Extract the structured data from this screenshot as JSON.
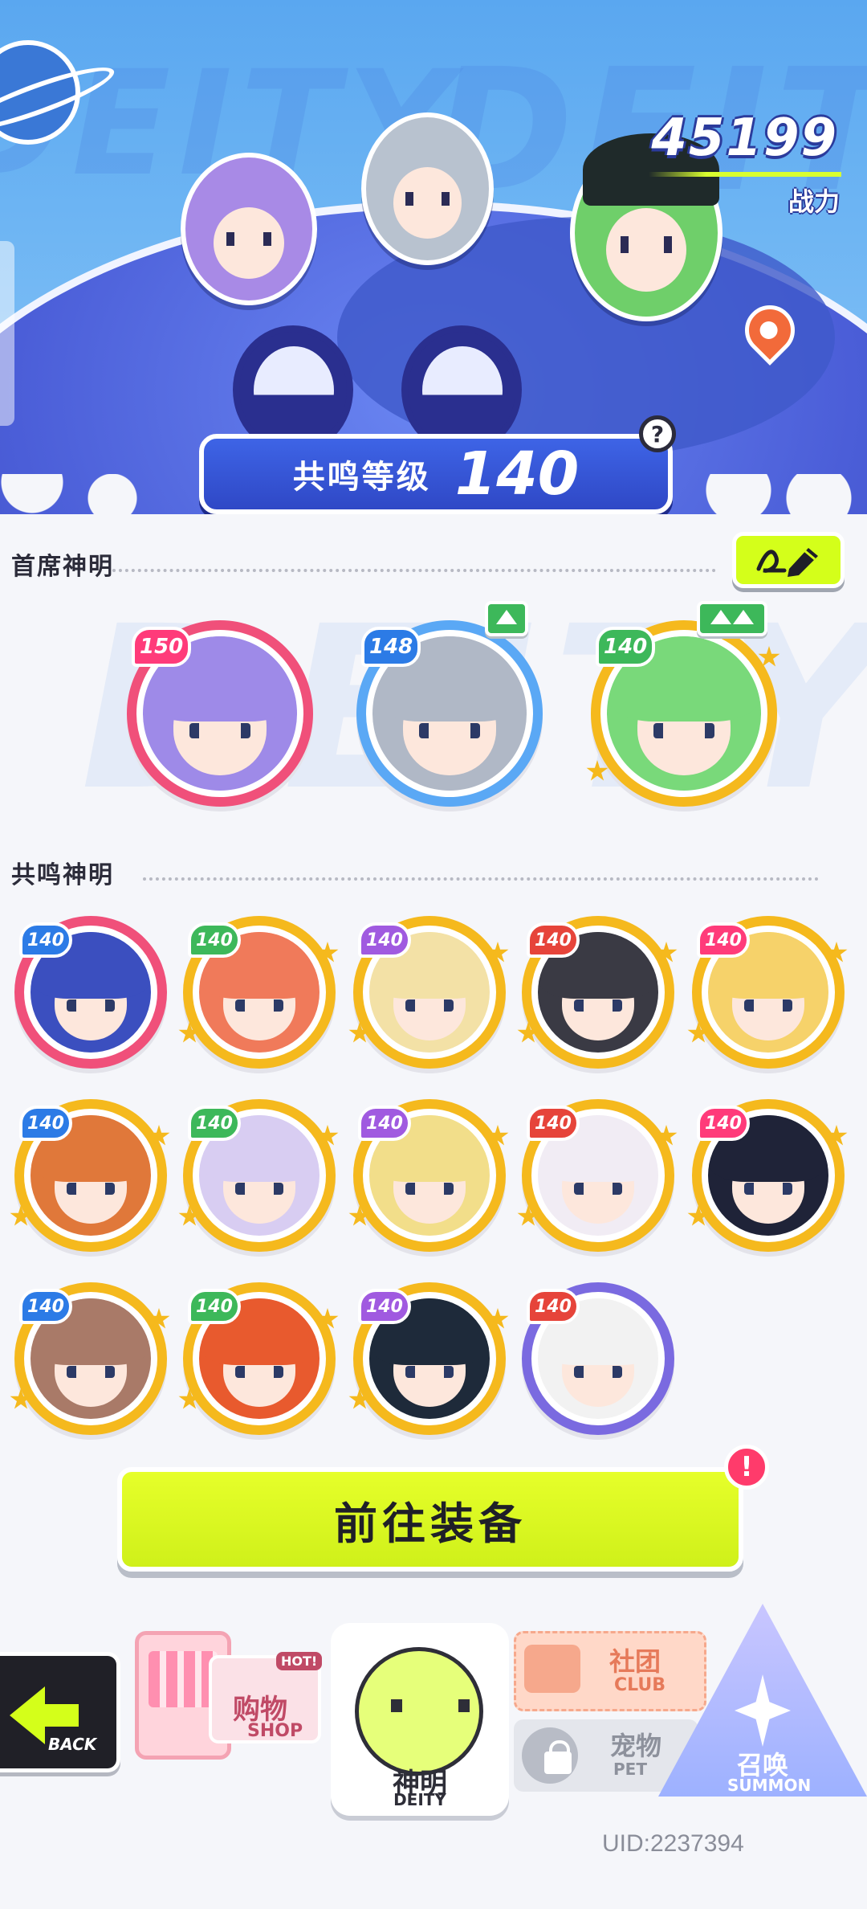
{
  "hero": {
    "power_value": "45199",
    "power_label": "战力",
    "bg_text": "DEITY",
    "resonance_label": "共鸣等级",
    "resonance_value": "140",
    "help_icon": "?"
  },
  "sections": {
    "chief_title": "首席神明",
    "resonance_title": "共鸣神明"
  },
  "chief_deities": [
    {
      "level": "150",
      "frame": "#f0507a",
      "hair": "#9e8ae8",
      "upgrade": 0
    },
    {
      "level": "148",
      "frame": "#5aa8f5",
      "hair": "#b0b8c6",
      "upgrade": 1
    },
    {
      "level": "140",
      "frame": "#f5b91d",
      "hair": "#79d97a",
      "upgrade": 2
    }
  ],
  "resonance_deities": [
    {
      "level": "140",
      "frame": "#f0507a",
      "hair": "#3b4fbf"
    },
    {
      "level": "140",
      "frame": "#f5b91d",
      "hair": "#f07a5a"
    },
    {
      "level": "140",
      "frame": "#f5b91d",
      "hair": "#f3e1a6"
    },
    {
      "level": "140",
      "frame": "#f5b91d",
      "hair": "#3a3a44"
    },
    {
      "level": "140",
      "frame": "#f5b91d",
      "hair": "#f6d26a"
    },
    {
      "level": "140",
      "frame": "#f5b91d",
      "hair": "#e0783a"
    },
    {
      "level": "140",
      "frame": "#f5b91d",
      "hair": "#d8cdf2"
    },
    {
      "level": "140",
      "frame": "#f5b91d",
      "hair": "#f2de8a"
    },
    {
      "level": "140",
      "frame": "#f5b91d",
      "hair": "#f1ecf4"
    },
    {
      "level": "140",
      "frame": "#f5b91d",
      "hair": "#1f2338"
    },
    {
      "level": "140",
      "frame": "#f5b91d",
      "hair": "#a97a68"
    },
    {
      "level": "140",
      "frame": "#f5b91d",
      "hair": "#e85a2e"
    },
    {
      "level": "140",
      "frame": "#f5b91d",
      "hair": "#1e2a3a"
    },
    {
      "level": "140",
      "frame": "#7a6ae0",
      "hair": "#f2f2f2"
    }
  ],
  "level_badge_colors": [
    "#ff3b7a",
    "#2c7be6",
    "#3db85a",
    "#a05ae0",
    "#e6443a"
  ],
  "equip_button": "前往装备",
  "equip_badge": "!",
  "nav": {
    "back_label": "BACK",
    "shop_cn": "购物",
    "shop_en": "SHOP",
    "shop_hot": "HOT!",
    "deity_cn": "神明",
    "deity_en": "DEITY",
    "club_cn": "社团",
    "club_en": "CLUB",
    "pet_cn": "宠物",
    "pet_en": "PET",
    "summon_cn": "召唤",
    "summon_en": "SUMMON"
  },
  "uid": "UID:2237394",
  "colors": {
    "accent_lime": "#d4ff1a",
    "hero_blue": "#5aa7f0",
    "banner_blue": "#3e64e6",
    "badge_red": "#ff3b6b"
  }
}
